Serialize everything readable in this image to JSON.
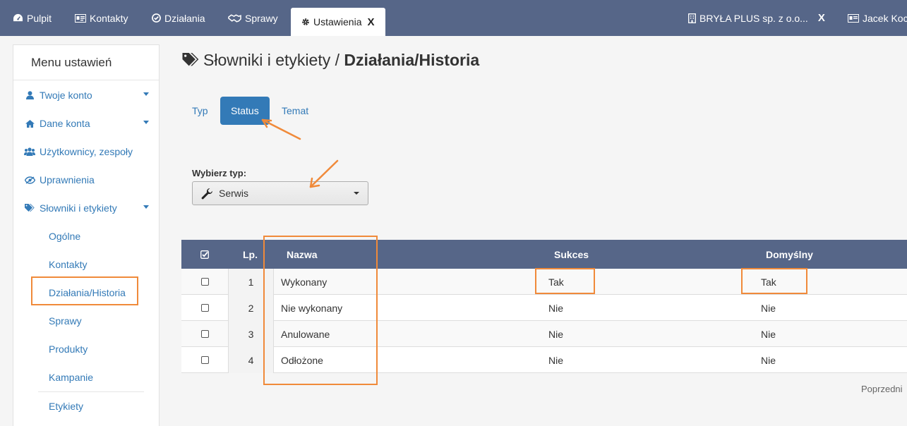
{
  "topnav": {
    "items": [
      {
        "label": "Pulpit",
        "icon": "dashboard-icon"
      },
      {
        "label": "Kontakty",
        "icon": "contact-card-icon"
      },
      {
        "label": "Działania",
        "icon": "check-circle-icon"
      },
      {
        "label": "Sprawy",
        "icon": "handshake-icon"
      },
      {
        "label": "Ustawienia",
        "icon": "gear-icon",
        "close": "X"
      }
    ],
    "company": {
      "label": "BRYŁA PLUS sp. z o.o...",
      "icon": "building-icon",
      "close": "X"
    },
    "user": {
      "label": "Jacek Koc",
      "icon": "user-card-icon"
    }
  },
  "sidebar": {
    "title": "Menu ustawień",
    "items": [
      {
        "label": "Twoje konto",
        "icon": "user-icon"
      },
      {
        "label": "Dane konta",
        "icon": "home-icon"
      },
      {
        "label": "Użytkownicy, zespoły",
        "icon": "users-icon"
      },
      {
        "label": "Uprawnienia",
        "icon": "eye-slash-icon"
      },
      {
        "label": "Słowniki i etykiety",
        "icon": "tags-icon"
      }
    ],
    "subitems": [
      {
        "label": "Ogólne"
      },
      {
        "label": "Kontakty"
      },
      {
        "label": "Działania/Historia"
      },
      {
        "label": "Sprawy"
      },
      {
        "label": "Produkty"
      },
      {
        "label": "Kampanie"
      },
      {
        "label": "Etykiety"
      }
    ]
  },
  "page": {
    "title_prefix": "Słowniki i etykiety / ",
    "title_bold": "Działania/Historia"
  },
  "tabs": [
    {
      "label": "Typ"
    },
    {
      "label": "Status"
    },
    {
      "label": "Temat"
    }
  ],
  "filter": {
    "label": "Wybierz typ:",
    "value": "Serwis",
    "icon": "wrench-icon"
  },
  "table": {
    "headers": {
      "lp": "Lp.",
      "name": "Nazwa",
      "success": "Sukces",
      "default": "Domyślny"
    },
    "rows": [
      {
        "lp": "1",
        "name": "Wykonany",
        "success": "Tak",
        "default": "Tak"
      },
      {
        "lp": "2",
        "name": "Nie wykonany",
        "success": "Nie",
        "default": "Nie"
      },
      {
        "lp": "3",
        "name": "Anulowane",
        "success": "Nie",
        "default": "Nie"
      },
      {
        "lp": "4",
        "name": "Odłożone",
        "success": "Nie",
        "default": "Nie"
      }
    ]
  },
  "pager": {
    "prev": "Poprzedni"
  },
  "colors": {
    "navbar": "#566688",
    "link": "#337ab7",
    "annotation": "#f08a3a"
  }
}
